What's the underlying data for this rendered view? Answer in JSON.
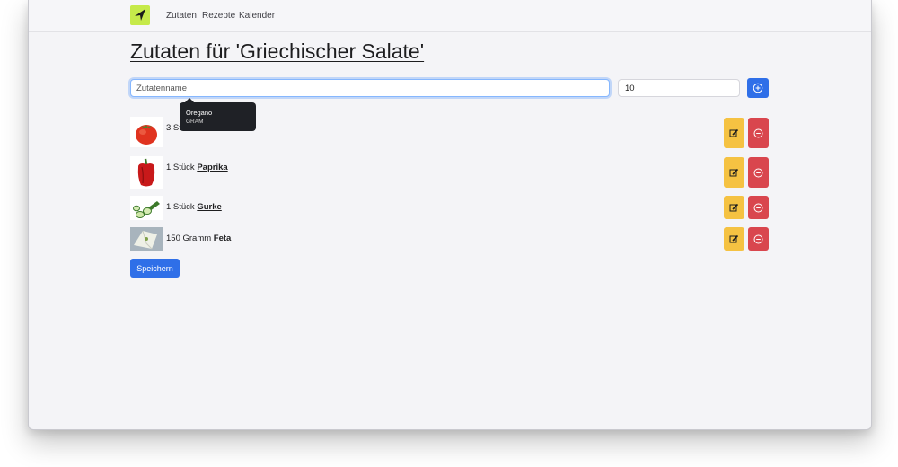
{
  "nav": {
    "links": [
      "Zutaten",
      "Rezepte",
      "Kalender"
    ]
  },
  "page": {
    "title": "Zutaten für 'Griechischer Salate'"
  },
  "form": {
    "name_placeholder": "Zutatenname",
    "quantity_value": "10"
  },
  "tooltip": {
    "name": "Oregano",
    "unit": "GRAM"
  },
  "items": [
    {
      "amount": "3 St",
      "name": "",
      "image": "tomato-image"
    },
    {
      "amount": "1 Stück",
      "name": "Paprika",
      "image": "bell-pepper-image"
    },
    {
      "amount": "1 Stück",
      "name": "Gurke",
      "image": "cucumber-image"
    },
    {
      "amount": "150 Gramm",
      "name": "Feta",
      "image": "feta-image"
    }
  ],
  "actions": {
    "save_label": "Speichern"
  },
  "colors": {
    "primary": "#2f6fe8",
    "warning": "#f5c242",
    "danger": "#d9464e",
    "logo": "#c6ea4a"
  },
  "icons": [
    "logo-icon",
    "plus-circle-icon",
    "edit-icon",
    "minus-circle-icon"
  ]
}
